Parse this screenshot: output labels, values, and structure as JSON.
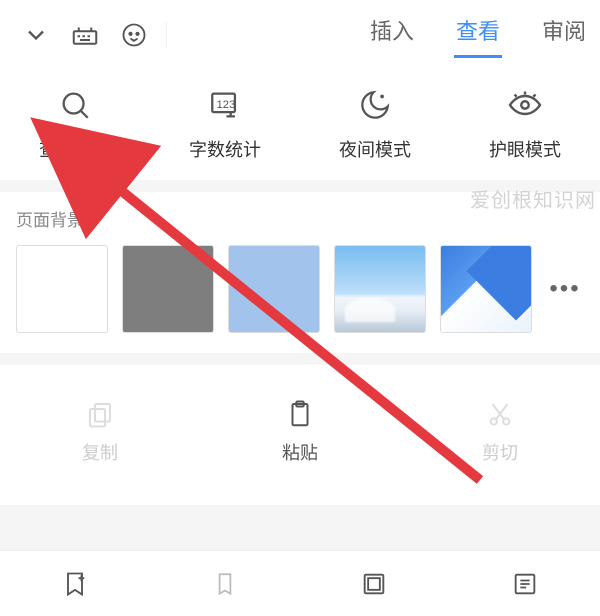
{
  "tabs": {
    "insert": "插入",
    "view": "查看",
    "review": "审阅"
  },
  "quick": {
    "find_replace": "查找替换",
    "word_count": "字数统计",
    "night_mode": "夜间模式",
    "eye_mode": "护眼模式"
  },
  "bg_section_title": "页面背景",
  "more_label": "•••",
  "clip": {
    "copy": "复制",
    "paste": "粘贴",
    "cut": "剪切"
  },
  "watermark": "爱创根知识网",
  "colors": {
    "accent": "#3d8ef5",
    "arrow": "#e53940"
  },
  "swatches": [
    {
      "name": "white",
      "value": "#ffffff"
    },
    {
      "name": "gray",
      "value": "#7e7e7e"
    },
    {
      "name": "light-blue",
      "value": "#a2c4ec"
    },
    {
      "name": "sky-theme",
      "value": "sky"
    },
    {
      "name": "cloud-theme",
      "value": "cloud"
    }
  ]
}
